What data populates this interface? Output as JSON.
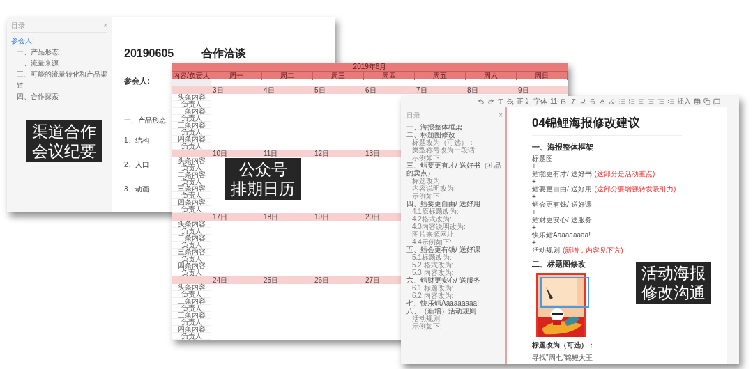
{
  "meeting_notes": {
    "outline_title": "目录",
    "close": "×",
    "outline": [
      {
        "label": "参会人:",
        "selected": true
      },
      {
        "label": "一、产品形态",
        "selected": false
      },
      {
        "label": "二、流量来源",
        "selected": false
      },
      {
        "label": "三、可能的流量转化和产品渠道",
        "selected": false
      },
      {
        "label": "四、合作探索",
        "selected": false
      }
    ],
    "date": "20190605",
    "title": "合作洽谈",
    "attendees_label": "参会人:",
    "section": "一、产品形态:",
    "items": [
      "1、结构",
      "2、入口",
      "3、动画"
    ],
    "caption": [
      "渠道合作",
      "会议纪要"
    ]
  },
  "calendar": {
    "month": "2019年6月",
    "columns": [
      "内容/负责人",
      "周一",
      "周二",
      "周三",
      "周四",
      "周五",
      "周六",
      "周日"
    ],
    "weeks": [
      {
        "days": [
          "3日",
          "4日",
          "5日",
          "6日",
          "7日",
          "8日",
          "9日"
        ],
        "rows": [
          "头条内容",
          "负责人",
          "二条内容",
          "负责人",
          "三条内容",
          "负责人",
          "四条内容",
          "负责人"
        ]
      },
      {
        "days": [
          "10日",
          "11日",
          "12日",
          "13日"
        ],
        "rows": [
          "头条内容",
          "负责人",
          "二条内容",
          "负责人",
          "三条内容",
          "负责人",
          "四条内容",
          "负责人"
        ]
      },
      {
        "days": [
          "17日",
          "18日",
          "19日",
          "20日"
        ],
        "rows": [
          "头条内容",
          "负责人",
          "二条内容",
          "负责人",
          "三条内容",
          "负责人",
          "四条内容",
          "负责人"
        ]
      },
      {
        "days": [
          "24日",
          "25日",
          "26日",
          "27日"
        ],
        "rows": [
          "头条内容",
          "负责人",
          "二条内容",
          "负责人",
          "三条内容",
          "负责人",
          "四条内容",
          "负责人"
        ]
      }
    ],
    "caption": [
      "公众号",
      "排期日历"
    ]
  },
  "poster_doc": {
    "toolbar": {
      "style": "正文",
      "font": "字体",
      "size": "11",
      "insert": "插入"
    },
    "outline_title": "目录",
    "close": "×",
    "outline": [
      {
        "label": "一、海报整体框架"
      },
      {
        "label": "二、标题图修改",
        "children": [
          {
            "label": "标题改为（可选）："
          },
          {
            "label": "类型称号改为一段话:"
          },
          {
            "label": "示例如下:"
          }
        ]
      },
      {
        "label": "三、鳕要更有才/ 送好书（礼品的卖点）",
        "children": [
          {
            "label": "标题改为:"
          },
          {
            "label": "内容说明改为:"
          },
          {
            "label": "示例如下:"
          }
        ]
      },
      {
        "label": "四、鳕要更自由/ 送好用",
        "children": [
          {
            "label": "4.1原标题改为:"
          },
          {
            "label": "4.2格式改为:"
          },
          {
            "label": "4.3内容说明改为:"
          },
          {
            "label": "图片来源网址:"
          },
          {
            "label": "4.4示例如下:"
          }
        ]
      },
      {
        "label": "五、鳕会更有钱/ 送好课",
        "children": [
          {
            "label": "5.1标题改为:"
          },
          {
            "label": "5.2 格式改为:"
          },
          {
            "label": "5.3 内容改为:"
          }
        ]
      },
      {
        "label": "六、鳕财更安心/ 送服务",
        "children": [
          {
            "label": "6.1 标题改为:"
          },
          {
            "label": "6.2 内容改为:"
          }
        ]
      },
      {
        "label": "七、快乐鳕Aaaaaaaaa!"
      },
      {
        "label": "八、（新增）活动规则",
        "children": [
          {
            "label": "活动规则:"
          },
          {
            "label": "示例如下:"
          }
        ]
      }
    ],
    "title": "04锦鲤海报修改建议",
    "section1": "一、海报整体框架",
    "lines": [
      {
        "text": "标题图"
      },
      {
        "text": "+"
      },
      {
        "text": "鳕能更有才/ 送好书",
        "note": "(这部分是活动重点)"
      },
      {
        "text": "+"
      },
      {
        "text": "鳕要更自由/ 送好用",
        "note": "(这部分要增强转发吸引力)"
      },
      {
        "text": "+"
      },
      {
        "text": "鳕会更有钱/ 送好课"
      },
      {
        "text": "+"
      },
      {
        "text": "鳕财更安心/ 送服务"
      },
      {
        "text": "+"
      },
      {
        "text": "快乐鳕Aaaaaaaaa!"
      },
      {
        "text": "+"
      },
      {
        "text": "活动规则",
        "note": "(新增，内容见下方)"
      }
    ],
    "section2": "二、标题图修改",
    "subheading": "标题改为（可选）：",
    "last_line": "寻找\"周七\"锦鲤大王",
    "caption": [
      "活动海报",
      "修改沟通"
    ]
  }
}
